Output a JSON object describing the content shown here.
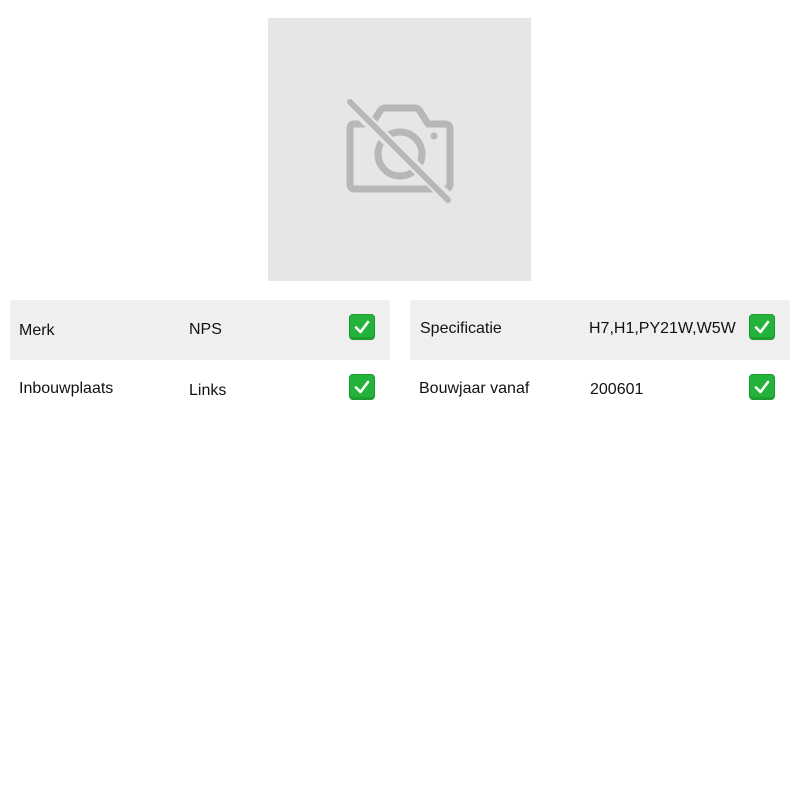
{
  "product_image": {
    "icon": "camera-off-icon",
    "placeholder_bg": "#e6e6e6",
    "icon_color": "#b7b7b7"
  },
  "specs_left": [
    {
      "label": "Merk",
      "value": "NPS",
      "status_icon": "check-mark-icon"
    },
    {
      "label": "Inbouwplaats",
      "value": "Links",
      "status_icon": "check-mark-icon"
    }
  ],
  "specs_right": [
    {
      "label": "Specificatie",
      "value": "H7,H1,PY21W,W5W",
      "status_icon": "check-mark-icon"
    },
    {
      "label": "Bouwjaar vanaf",
      "value": "200601",
      "status_icon": "check-mark-icon"
    }
  ],
  "colors": {
    "row_shade": "#efefef",
    "check_green": "#23b33a"
  }
}
